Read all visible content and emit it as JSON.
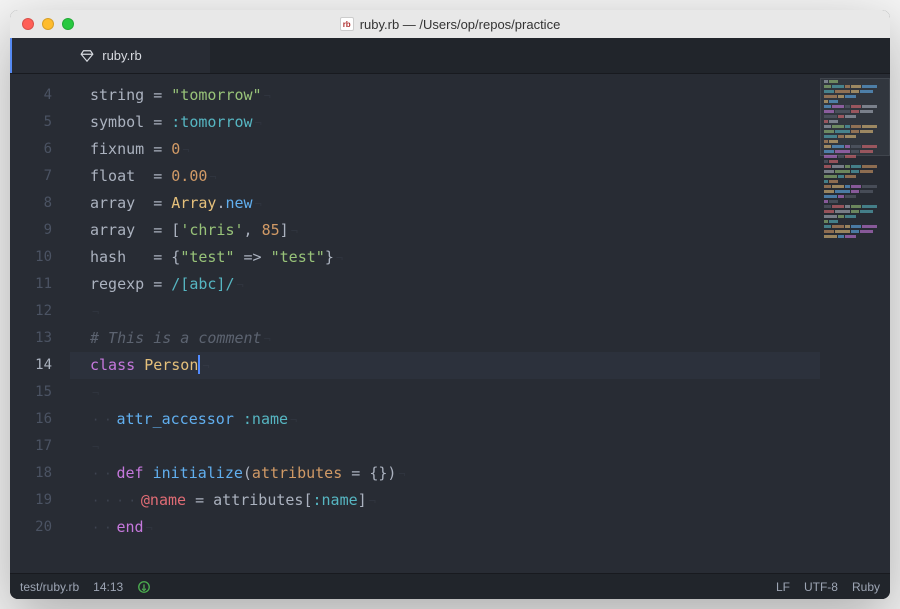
{
  "window": {
    "title": "ruby.rb — /Users/op/repos/practice",
    "file_badge": "rb"
  },
  "tab": {
    "filename": "ruby.rb"
  },
  "editor": {
    "active_line": 14,
    "line_numbers": [
      "4",
      "5",
      "6",
      "7",
      "8",
      "9",
      "10",
      "11",
      "12",
      "13",
      "14",
      "15",
      "16",
      "17",
      "18",
      "19",
      "20"
    ],
    "lines": [
      [
        {
          "t": "ident",
          "v": "string"
        },
        {
          "t": "op",
          "v": " = "
        },
        {
          "t": "str",
          "v": "\"tomorrow\""
        }
      ],
      [
        {
          "t": "ident",
          "v": "symbol"
        },
        {
          "t": "op",
          "v": " = "
        },
        {
          "t": "sym",
          "v": ":tomorrow"
        }
      ],
      [
        {
          "t": "ident",
          "v": "fixnum"
        },
        {
          "t": "op",
          "v": " = "
        },
        {
          "t": "num",
          "v": "0"
        }
      ],
      [
        {
          "t": "ident",
          "v": "float "
        },
        {
          "t": "op",
          "v": " = "
        },
        {
          "t": "num",
          "v": "0.00"
        }
      ],
      [
        {
          "t": "ident",
          "v": "array "
        },
        {
          "t": "op",
          "v": " = "
        },
        {
          "t": "const",
          "v": "Array"
        },
        {
          "t": "op",
          "v": "."
        },
        {
          "t": "call",
          "v": "new"
        }
      ],
      [
        {
          "t": "ident",
          "v": "array "
        },
        {
          "t": "op",
          "v": " = ["
        },
        {
          "t": "str",
          "v": "'chris'"
        },
        {
          "t": "op",
          "v": ", "
        },
        {
          "t": "num",
          "v": "85"
        },
        {
          "t": "op",
          "v": "]"
        }
      ],
      [
        {
          "t": "ident",
          "v": "hash  "
        },
        {
          "t": "op",
          "v": " = {"
        },
        {
          "t": "str",
          "v": "\"test\""
        },
        {
          "t": "op",
          "v": " => "
        },
        {
          "t": "str",
          "v": "\"test\""
        },
        {
          "t": "op",
          "v": "}"
        }
      ],
      [
        {
          "t": "ident",
          "v": "regexp"
        },
        {
          "t": "op",
          "v": " = "
        },
        {
          "t": "regex",
          "v": "/[abc]/"
        }
      ],
      [],
      [
        {
          "t": "comment",
          "v": "# This is a comment"
        }
      ],
      [
        {
          "t": "kw",
          "v": "class"
        },
        {
          "t": "op",
          "v": " "
        },
        {
          "t": "const",
          "v": "Person"
        },
        {
          "t": "cursor",
          "v": ""
        }
      ],
      [],
      [
        {
          "t": "indent",
          "v": "  "
        },
        {
          "t": "call",
          "v": "attr_accessor"
        },
        {
          "t": "op",
          "v": " "
        },
        {
          "t": "sym",
          "v": ":name"
        }
      ],
      [],
      [
        {
          "t": "indent",
          "v": "  "
        },
        {
          "t": "kw",
          "v": "def"
        },
        {
          "t": "op",
          "v": " "
        },
        {
          "t": "call",
          "v": "initialize"
        },
        {
          "t": "op",
          "v": "("
        },
        {
          "t": "param",
          "v": "attributes"
        },
        {
          "t": "op",
          "v": " = {})"
        }
      ],
      [
        {
          "t": "indent",
          "v": "    "
        },
        {
          "t": "ivar",
          "v": "@name"
        },
        {
          "t": "op",
          "v": " = "
        },
        {
          "t": "ident",
          "v": "attributes["
        },
        {
          "t": "sym",
          "v": ":name"
        },
        {
          "t": "ident",
          "v": "]"
        }
      ],
      [
        {
          "t": "indent",
          "v": "  "
        },
        {
          "t": "kw",
          "v": "end"
        }
      ]
    ]
  },
  "statusbar": {
    "path": "test/ruby.rb",
    "cursor_pos": "14:13",
    "line_ending": "LF",
    "encoding": "UTF-8",
    "language": "Ruby"
  }
}
